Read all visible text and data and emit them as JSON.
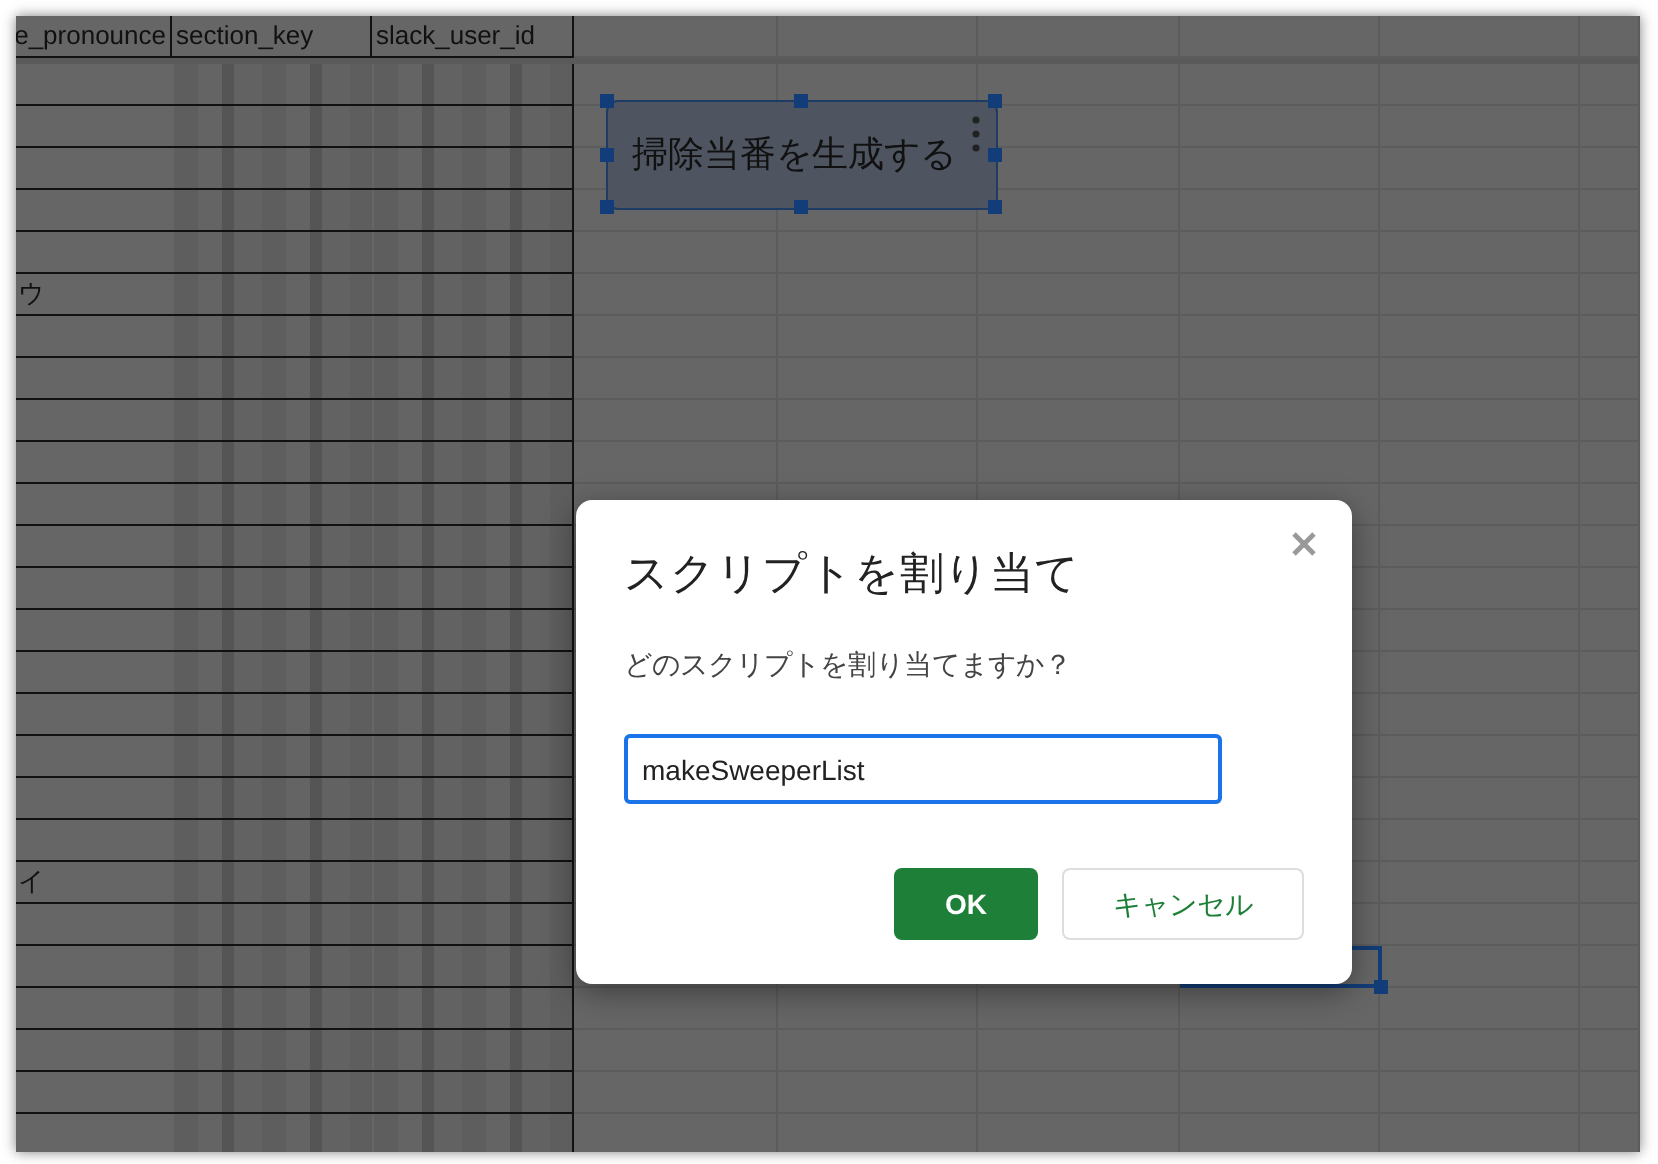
{
  "sheet": {
    "columns": [
      {
        "label": "e_pronounce"
      },
      {
        "label": "section_key"
      },
      {
        "label": "slack_user_id"
      }
    ],
    "rows": [
      {},
      {},
      {},
      {},
      {},
      {
        "column_1": "ウ"
      },
      {},
      {},
      {},
      {},
      {},
      {},
      {},
      {},
      {},
      {},
      {},
      {},
      {},
      {
        "column_1": "イ"
      },
      {},
      {},
      {},
      {},
      {},
      {}
    ]
  },
  "drawing": {
    "label": "掃除当番を生成する",
    "selected": true
  },
  "dialog": {
    "title": "スクリプトを割り当て",
    "prompt": "どのスクリプトを割り当てますか？",
    "input": {
      "value": "makeSweeperList"
    },
    "buttons": [
      {
        "label": "OK",
        "kind": "primary"
      },
      {
        "label": "キャンセル",
        "kind": "secondary"
      }
    ]
  }
}
